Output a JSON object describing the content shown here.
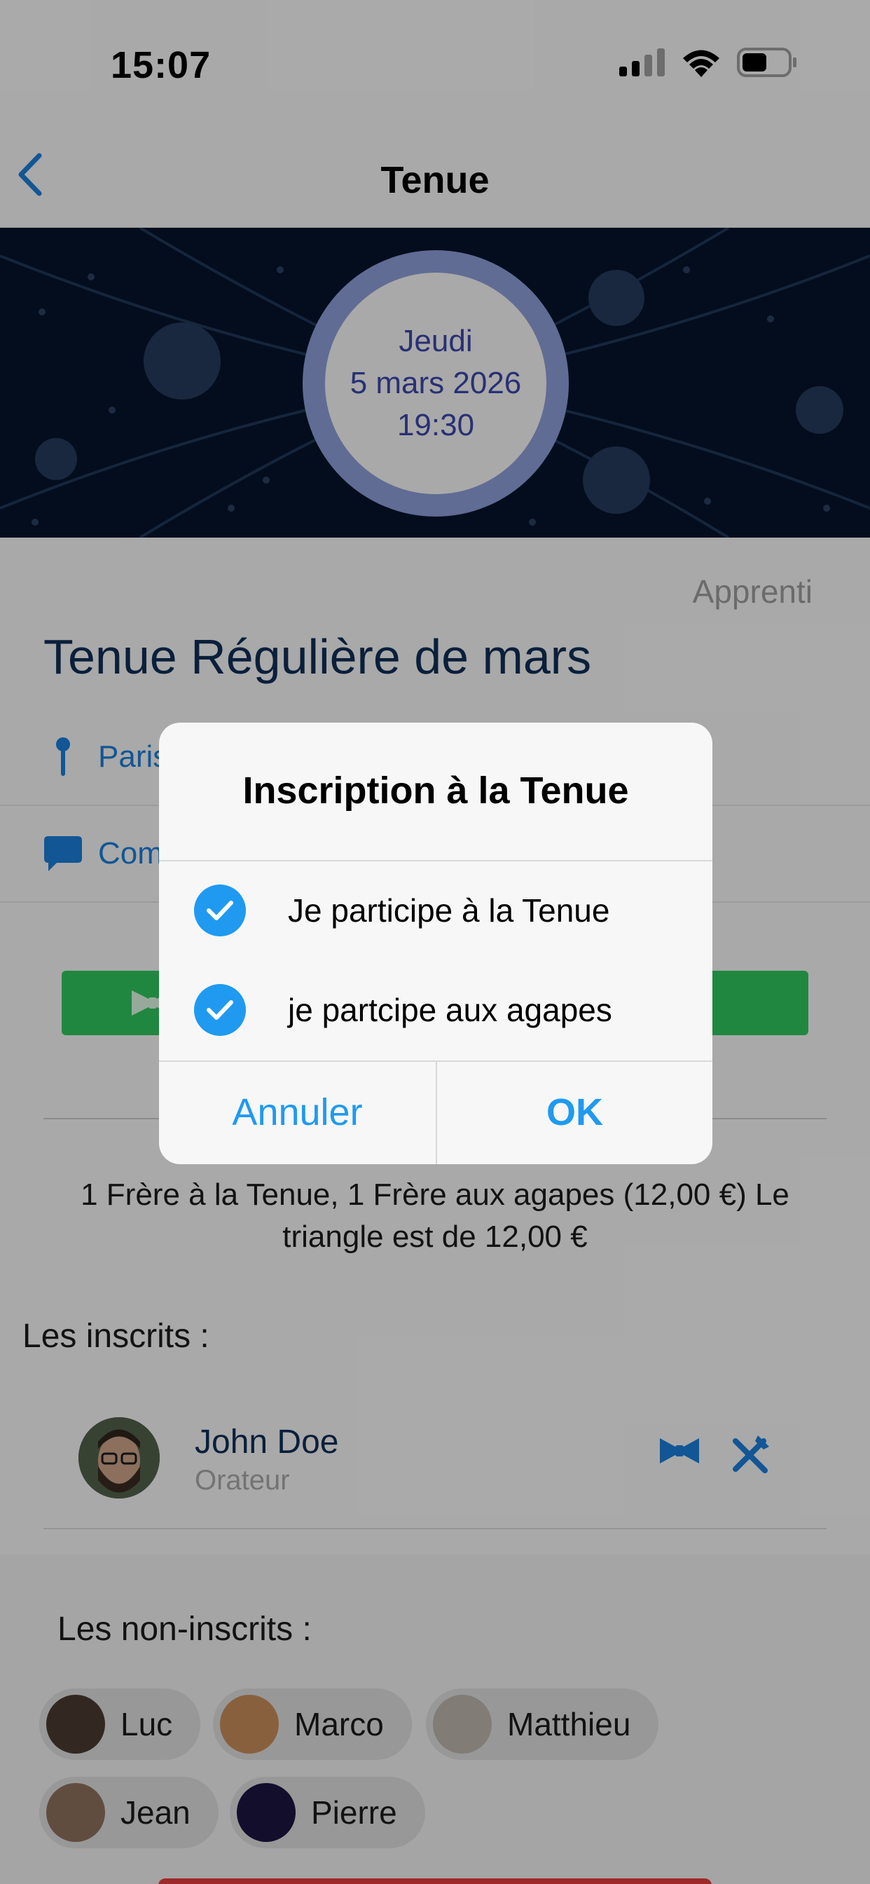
{
  "status_bar": {
    "time": "15:07"
  },
  "nav": {
    "title": "Tenue"
  },
  "banner": {
    "date_day": "Jeudi",
    "date_full": "5 mars 2026",
    "date_time": "19:30"
  },
  "event": {
    "grade": "Apprenti",
    "title": "Tenue Régulière de mars",
    "location": "Paris",
    "comment": "Com"
  },
  "summary": {
    "line1": "1 Frère à la Tenue, 1 Frère aux agapes (12,00 €) Le",
    "line2": "triangle est de 12,00 €"
  },
  "inscrits": {
    "heading": "Les inscrits :",
    "members": [
      {
        "name": "John Doe",
        "role": "Orateur"
      }
    ]
  },
  "non_inscrits": {
    "heading": "Les non-inscrits :",
    "people": [
      "Luc",
      "Marco",
      "Matthieu",
      "Jean",
      "Pierre"
    ]
  },
  "dialog": {
    "title": "Inscription à la Tenue",
    "options": [
      {
        "label": "Je participe à la Tenue",
        "checked": true
      },
      {
        "label": "je partcipe aux agapes",
        "checked": true
      }
    ],
    "cancel_label": "Annuler",
    "ok_label": "OK"
  },
  "colors": {
    "accent": "#1f9af0",
    "link": "#1a7bd6",
    "title": "#0f2d55",
    "green": "#2ec25c",
    "ring": "#8a9bd5",
    "date_text": "#3b45a8"
  }
}
